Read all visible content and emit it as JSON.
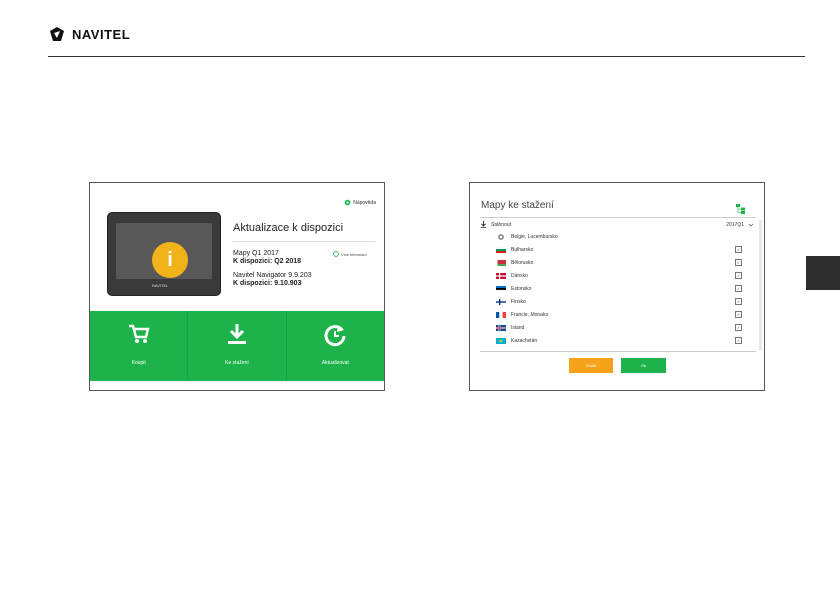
{
  "header": {
    "brand": "NAVITEL"
  },
  "left_panel": {
    "help_label": "Nápověda",
    "title": "Aktualizace k dispozici",
    "more_info": "Více informací",
    "device_brand": "NAVITEL",
    "maps_line": "Mapy Q1 2017",
    "maps_available": "K dispozici: Q2 2018",
    "navigator_line": "Navitel Navigator 9.9.203",
    "navigator_available": "K dispozici: 9.10.903",
    "buttons": [
      {
        "label": "Koupit",
        "icon": "cart-icon"
      },
      {
        "label": "Ke stažení",
        "icon": "download-icon"
      },
      {
        "label": "Aktualizovat",
        "icon": "refresh-icon"
      }
    ],
    "colors": {
      "accent": "#1db34a",
      "info": "#f2b21a"
    }
  },
  "right_panel": {
    "title": "Mapy ke stažení",
    "download_label": "Stáhnout",
    "version": "2017Q1",
    "countries": [
      {
        "name": "Belgie, Lucembursko"
      },
      {
        "name": "Bulharsko"
      },
      {
        "name": "Bělorusko"
      },
      {
        "name": "Dánsko"
      },
      {
        "name": "Estonsko"
      },
      {
        "name": "Finsko"
      },
      {
        "name": "Francie, Monako"
      },
      {
        "name": "Island"
      },
      {
        "name": "Kazachstán"
      }
    ],
    "cancel_label": "Zrušit",
    "ok_label": "Ok",
    "colors": {
      "cancel": "#f5a31b",
      "ok": "#1db34a"
    }
  }
}
